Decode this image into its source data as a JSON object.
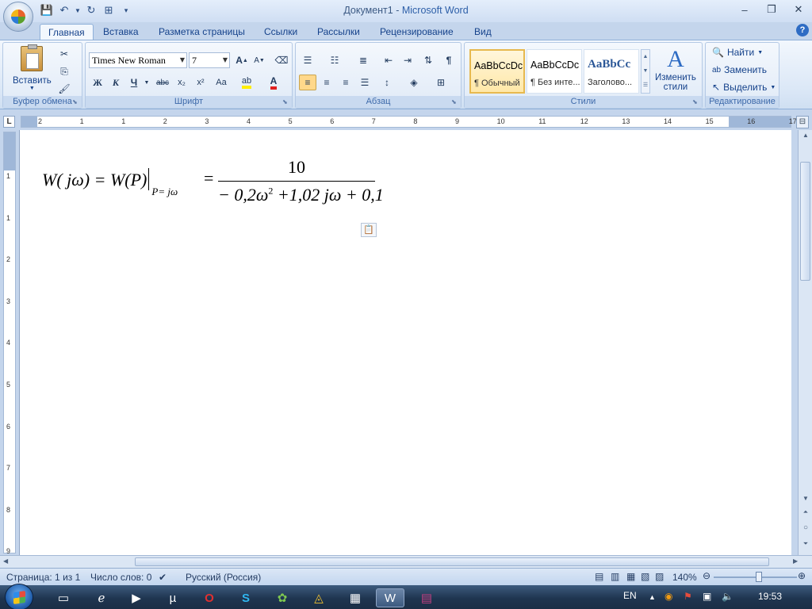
{
  "window": {
    "doc_name": "Документ1",
    "separator": " - ",
    "app_name": "Microsoft Word",
    "controls": [
      "‒",
      "❐",
      "✕"
    ]
  },
  "tabs": [
    "Главная",
    "Вставка",
    "Разметка страницы",
    "Ссылки",
    "Рассылки",
    "Рецензирование",
    "Вид"
  ],
  "ribbon": {
    "clipboard": {
      "label": "Буфер обмена",
      "paste": "Вставить"
    },
    "font": {
      "label": "Шрифт",
      "name": "Times New Roman",
      "size": "7",
      "buttons": {
        "bold": "Ж",
        "italic": "К",
        "underline": "Ч",
        "strike": "abc",
        "sub": "x₂",
        "sup": "x²",
        "case": "Aa",
        "grow": "A",
        "shrink": "A"
      }
    },
    "paragraph": {
      "label": "Абзац",
      "pilcrow": "¶"
    },
    "styles": {
      "label": "Стили",
      "tiles": [
        {
          "sample": "AaBbCcDc",
          "name": "¶ Обычный"
        },
        {
          "sample": "AaBbCcDc",
          "name": "¶ Без инте..."
        },
        {
          "sample": "AaBbCc",
          "name": "Заголово..."
        }
      ],
      "change_line1": "Изменить",
      "change_line2": "стили"
    },
    "editing": {
      "label": "Редактирование",
      "find": "Найти",
      "replace": "Заменить",
      "select": "Выделить"
    }
  },
  "ruler": {
    "corner": "L",
    "h_numbers": [
      "2",
      "1",
      "1",
      "2",
      "3",
      "4",
      "5",
      "6",
      "7",
      "8",
      "9",
      "10",
      "11",
      "12",
      "13",
      "14",
      "15",
      "16",
      "17"
    ],
    "v_numbers": [
      "1",
      "1",
      "2",
      "3",
      "4",
      "5",
      "6",
      "7",
      "8",
      "9"
    ]
  },
  "formula": {
    "lhs": "W( jω) = W(P)",
    "subscript": "P= jω",
    "equals": "=",
    "numerator": "10",
    "den_part1": "− 0,2ω",
    "den_exp": "2",
    "den_part2": " +1,02 jω + 0,1"
  },
  "status": {
    "page": "Страница: 1 из 1",
    "words": "Число слов: 0",
    "language": "Русский (Россия)",
    "zoom": "140%",
    "zoom_level": 1.4
  },
  "taskbar": {
    "language": "EN",
    "time": "19:53"
  },
  "colors": {
    "accent": "#15428b",
    "ribbon_bg": "#dce8f7",
    "selected_style": "#ffe8a8",
    "taskbar": "#1f3550"
  }
}
